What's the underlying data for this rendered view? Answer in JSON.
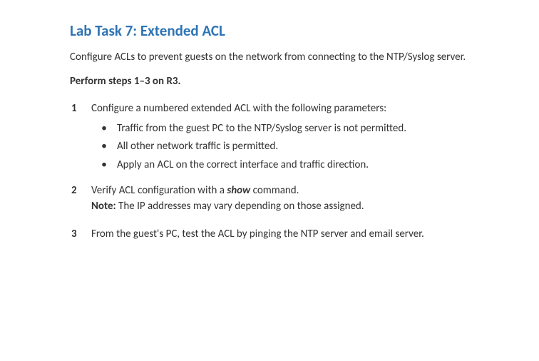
{
  "title": "Lab Task 7: Extended ACL",
  "intro": "Configure ACLs to prevent guests on the network from connecting to the NTP/Syslog server.",
  "instruction": "Perform steps 1–3 on R3.",
  "step1": {
    "num": "1",
    "text": "Configure a numbered extended ACL with the following parameters:",
    "bullets": {
      "b1": "Traffic from the guest PC to the NTP/Syslog server is not permitted.",
      "b2": "All other network traffic is permitted.",
      "b3": "Apply an ACL on the correct interface and traffic direction."
    }
  },
  "step2": {
    "num": "2",
    "text_before": "Verify ACL configuration with a ",
    "cmd": "show",
    "text_after": " command.",
    "note_label": "Note:",
    "note_text": " The IP addresses may vary depending on those assigned."
  },
  "step3": {
    "num": "3",
    "text": "From the guest's PC, test the ACL by pinging the NTP server and email server."
  }
}
